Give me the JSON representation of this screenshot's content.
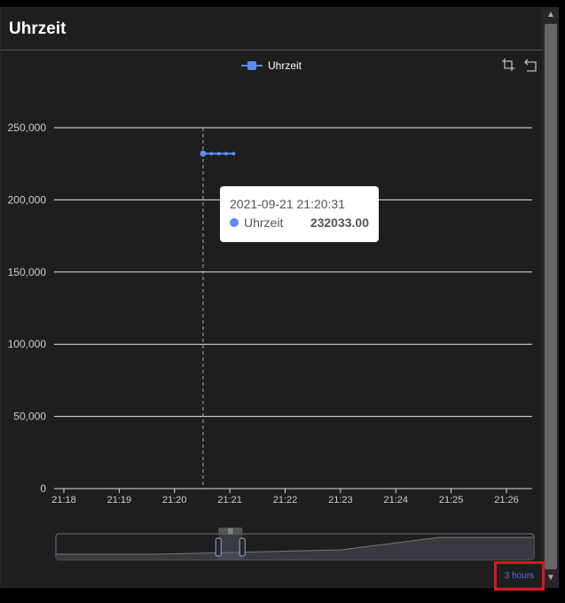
{
  "card": {
    "title": "Uhrzeit"
  },
  "legend": {
    "label": "Uhrzeit"
  },
  "toolbox": {
    "items": [
      "zoom-select-icon",
      "zoom-reset-icon"
    ]
  },
  "tooltip": {
    "timestamp": "2021-09-21 21:20:31",
    "series": "Uhrzeit",
    "value": "232033.00"
  },
  "range_button": {
    "label": "3 hours"
  },
  "colors": {
    "series": "#5a8df0",
    "background": "#1e1e1e",
    "highlight_box": "#e0141f"
  },
  "chart_data": {
    "type": "line",
    "xlabel": "",
    "ylabel": "",
    "x_tick_labels": [
      "21:18",
      "21:19",
      "21:20",
      "21:21",
      "21:22",
      "21:23",
      "21:24",
      "21:25",
      "21:26"
    ],
    "y_tick_labels": [
      "0",
      "50,000",
      "100,000",
      "150,000",
      "200,000",
      "250,000"
    ],
    "ylim": [
      0,
      250000
    ],
    "x_minutes": [
      0,
      8.4
    ],
    "series": [
      {
        "name": "Uhrzeit",
        "points": [
          {
            "t": "21:20:31",
            "y": 232033
          },
          {
            "t": "21:20:40",
            "y": 232033
          },
          {
            "t": "21:20:48",
            "y": 232033
          },
          {
            "t": "21:20:56",
            "y": 232033
          },
          {
            "t": "21:21:04",
            "y": 232033
          }
        ]
      }
    ],
    "grid": true,
    "legend": "top-center",
    "crosshair_at": "21:20:31",
    "dataZoom": {
      "start_fraction": 0.34,
      "end_fraction": 0.39
    }
  }
}
